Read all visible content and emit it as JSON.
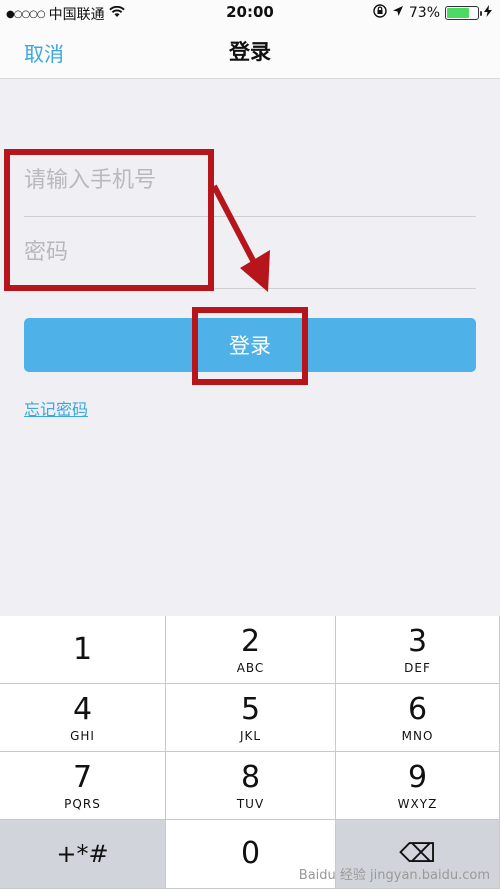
{
  "status_bar": {
    "carrier": "中国联通",
    "time": "20:00",
    "battery_percent": "73%",
    "battery_level": 0.73
  },
  "nav": {
    "cancel_label": "取消",
    "title": "登录"
  },
  "form": {
    "phone_placeholder": "请输入手机号",
    "password_placeholder": "密码",
    "login_label": "登录",
    "forgot_label": "忘记密码"
  },
  "keypad": {
    "keys": [
      {
        "num": "1",
        "letters": ""
      },
      {
        "num": "2",
        "letters": "ABC"
      },
      {
        "num": "3",
        "letters": "DEF"
      },
      {
        "num": "4",
        "letters": "GHI"
      },
      {
        "num": "5",
        "letters": "JKL"
      },
      {
        "num": "6",
        "letters": "MNO"
      },
      {
        "num": "7",
        "letters": "PQRS"
      },
      {
        "num": "8",
        "letters": "TUV"
      },
      {
        "num": "9",
        "letters": "WXYZ"
      },
      {
        "num": "+*#",
        "letters": ""
      },
      {
        "num": "0",
        "letters": ""
      },
      {
        "num": "⌫",
        "letters": ""
      }
    ]
  },
  "watermark": "Baidu 经验 jingyan.baidu.com",
  "colors": {
    "accent": "#3aa7e0",
    "button": "#4eb2e8",
    "annotation": "#b5151b",
    "battery": "#4cd964"
  }
}
